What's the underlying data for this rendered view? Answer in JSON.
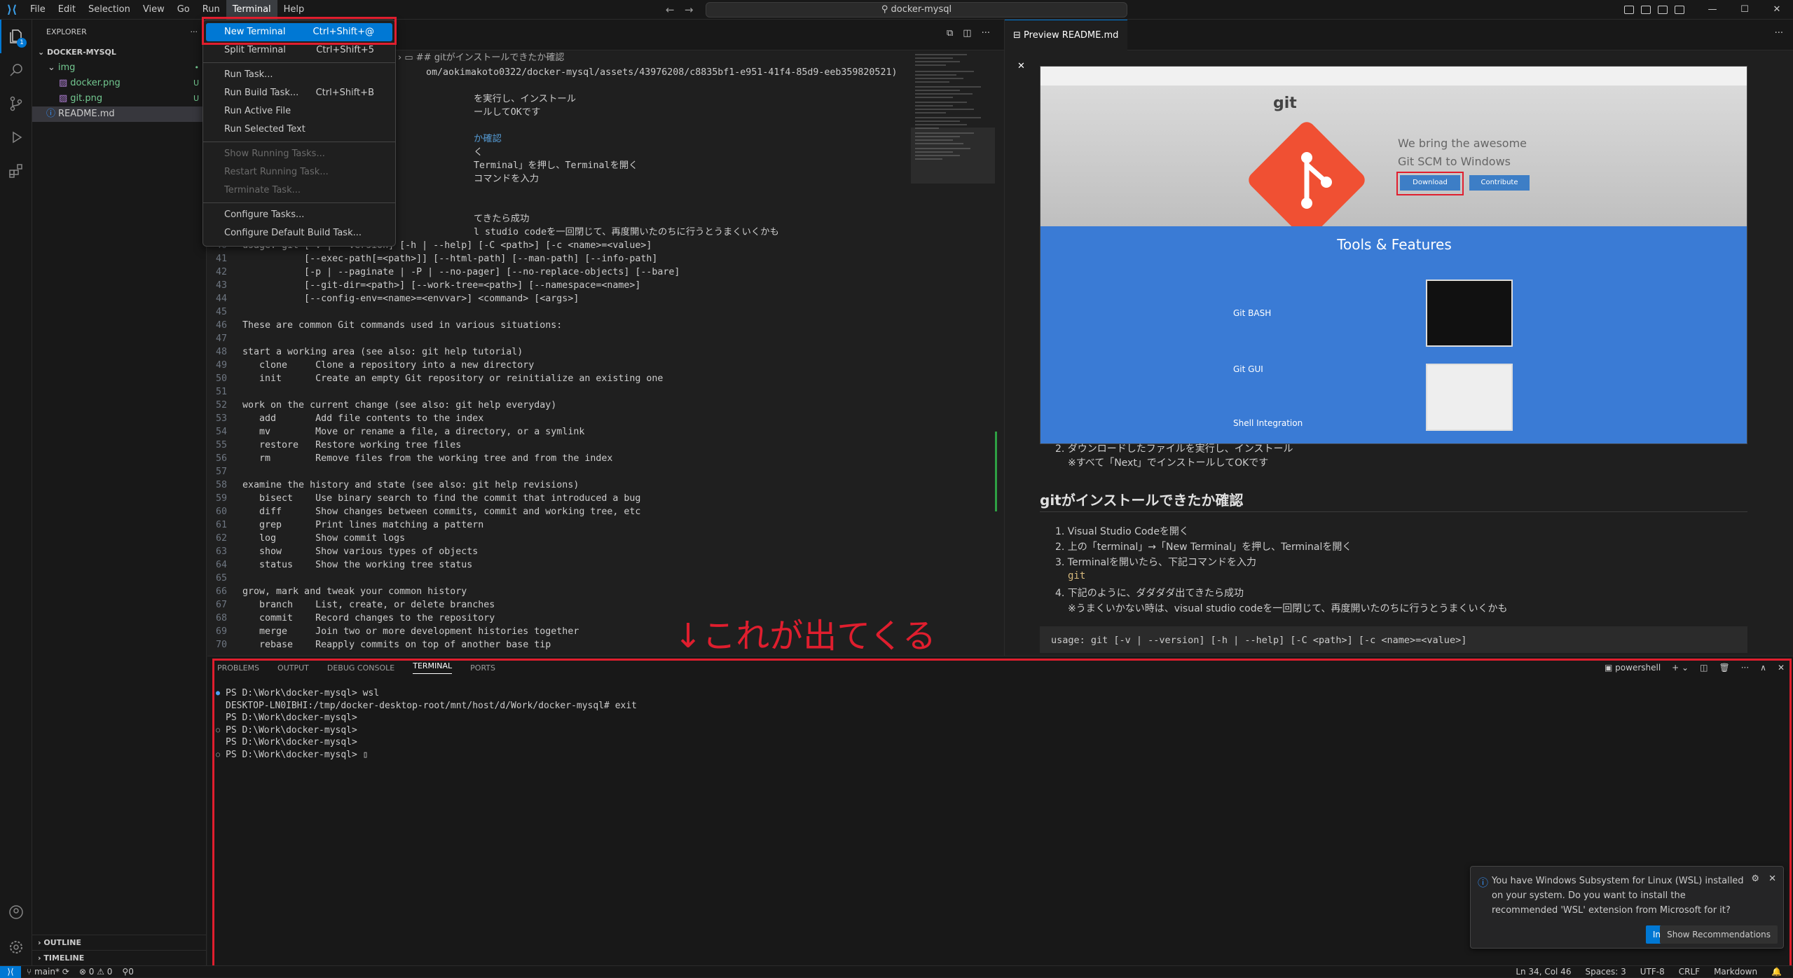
{
  "menubar": {
    "items": [
      "File",
      "Edit",
      "Selection",
      "View",
      "Go",
      "Run",
      "Terminal",
      "Help"
    ],
    "active": "Terminal"
  },
  "search": {
    "label": "docker-mysql"
  },
  "terminal_menu": {
    "items": [
      {
        "label": "New Terminal",
        "shortcut": "Ctrl+Shift+@",
        "state": "highlighted"
      },
      {
        "label": "Split Terminal",
        "shortcut": "Ctrl+Shift+5",
        "state": "normal"
      },
      {
        "label": "Run Task...",
        "shortcut": "",
        "state": "normal"
      },
      {
        "label": "Run Build Task...",
        "shortcut": "Ctrl+Shift+B",
        "state": "normal"
      },
      {
        "label": "Run Active File",
        "shortcut": "",
        "state": "normal"
      },
      {
        "label": "Run Selected Text",
        "shortcut": "",
        "state": "normal"
      },
      {
        "label": "Show Running Tasks...",
        "shortcut": "",
        "state": "disabled"
      },
      {
        "label": "Restart Running Task...",
        "shortcut": "",
        "state": "disabled"
      },
      {
        "label": "Terminate Task...",
        "shortcut": "",
        "state": "disabled"
      },
      {
        "label": "Configure Tasks...",
        "shortcut": "",
        "state": "normal"
      },
      {
        "label": "Configure Default Build Task...",
        "shortcut": "",
        "state": "normal"
      }
    ]
  },
  "sidebar": {
    "title": "EXPLORER",
    "root": "DOCKER-MYSQL",
    "tree": [
      {
        "name": "img",
        "type": "folder",
        "decoration": "•"
      },
      {
        "name": "docker.png",
        "type": "file",
        "decoration": "U"
      },
      {
        "name": "git.png",
        "type": "file",
        "decoration": "U"
      },
      {
        "name": "README.md",
        "type": "file",
        "decoration": ""
      }
    ],
    "outline": "OUTLINE",
    "timeline": "TIMELINE"
  },
  "editor": {
    "breadcrumb": "## gitがインストールできたか確認",
    "top_lines": [
      {
        "n": "",
        "t": "om/aokimakoto0322/docker-mysql/assets/43976208/c8835bf1-e951-41f4-85d9-eeb359820521)"
      },
      {
        "n": "",
        "t": ""
      },
      {
        "n": "",
        "t": "を実行し、インストール"
      },
      {
        "n": "",
        "t": "ールしてOKです"
      },
      {
        "n": "",
        "t": ""
      },
      {
        "n": "",
        "t": "か確認"
      },
      {
        "n": "",
        "t": "く"
      },
      {
        "n": "",
        "t": "Terminal」を押し、Terminalを開く"
      },
      {
        "n": "",
        "t": "コマンドを入力"
      },
      {
        "n": "",
        "t": ""
      },
      {
        "n": "",
        "t": ""
      },
      {
        "n": "",
        "t": "てきたら成功"
      },
      {
        "n": "",
        "t": "l studio codeを一回閉じて、再度開いたのちに行うとうまくいくかも"
      }
    ],
    "lines": [
      {
        "n": "40",
        "t": "usage: git [-v | --version] [-h | --help] [-C <path>] [-c <name>=<value>]"
      },
      {
        "n": "41",
        "t": "           [--exec-path[=<path>]] [--html-path] [--man-path] [--info-path]"
      },
      {
        "n": "42",
        "t": "           [-p | --paginate | -P | --no-pager] [--no-replace-objects] [--bare]"
      },
      {
        "n": "43",
        "t": "           [--git-dir=<path>] [--work-tree=<path>] [--namespace=<name>]"
      },
      {
        "n": "44",
        "t": "           [--config-env=<name>=<envvar>] <command> [<args>]"
      },
      {
        "n": "45",
        "t": ""
      },
      {
        "n": "46",
        "t": "These are common Git commands used in various situations:"
      },
      {
        "n": "47",
        "t": ""
      },
      {
        "n": "48",
        "t": "start a working area (see also: git help tutorial)"
      },
      {
        "n": "49",
        "t": "   clone     Clone a repository into a new directory"
      },
      {
        "n": "50",
        "t": "   init      Create an empty Git repository or reinitialize an existing one"
      },
      {
        "n": "51",
        "t": ""
      },
      {
        "n": "52",
        "t": "work on the current change (see also: git help everyday)"
      },
      {
        "n": "53",
        "t": "   add       Add file contents to the index"
      },
      {
        "n": "54",
        "t": "   mv        Move or rename a file, a directory, or a symlink"
      },
      {
        "n": "55",
        "t": "   restore   Restore working tree files"
      },
      {
        "n": "56",
        "t": "   rm        Remove files from the working tree and from the index"
      },
      {
        "n": "57",
        "t": ""
      },
      {
        "n": "58",
        "t": "examine the history and state (see also: git help revisions)"
      },
      {
        "n": "59",
        "t": "   bisect    Use binary search to find the commit that introduced a bug"
      },
      {
        "n": "60",
        "t": "   diff      Show changes between commits, commit and working tree, etc"
      },
      {
        "n": "61",
        "t": "   grep      Print lines matching a pattern"
      },
      {
        "n": "62",
        "t": "   log       Show commit logs"
      },
      {
        "n": "63",
        "t": "   show      Show various types of objects"
      },
      {
        "n": "64",
        "t": "   status    Show the working tree status"
      },
      {
        "n": "65",
        "t": ""
      },
      {
        "n": "66",
        "t": "grow, mark and tweak your common history"
      },
      {
        "n": "67",
        "t": "   branch    List, create, or delete branches"
      },
      {
        "n": "68",
        "t": "   commit    Record changes to the repository"
      },
      {
        "n": "69",
        "t": "   merge     Join two or more development histories together"
      },
      {
        "n": "70",
        "t": "   rebase    Reapply commits on top of another base tip"
      }
    ]
  },
  "preview": {
    "tab": "Preview README.md",
    "website": {
      "brand": "git",
      "tagline_1": "We bring the awesome",
      "tagline_2": "Git SCM to Windows",
      "download": "Download",
      "contribute": "Contribute",
      "section": "Tools & Features",
      "features": [
        "Git BASH",
        "Git GUI",
        "Shell Integration"
      ]
    },
    "list1": [
      "2. ダウンロードしたファイルを実行し、インストール",
      "※すべて「Next」でインストールしてOKです"
    ],
    "heading": "gitがインストールできたか確認",
    "list2": [
      "1. Visual Studio Codeを開く",
      "2. 上の「terminal」→「New Terminal」を押し、Terminalを開く",
      "3. Terminalを開いたら、下記コマンドを入力",
      "git",
      "4. 下記のように、ダダダダ出てきたら成功",
      "※うまくいかない時は、visual studio codeを一回閉じて、再度開いたのちに行うとうまくいくかも"
    ],
    "code": "usage: git [-v | --version] [-h | --help] [-C <path>] [-c <name>=<value>]"
  },
  "annotation": "↓これが出てくる",
  "panel": {
    "tabs": [
      "PROBLEMS",
      "OUTPUT",
      "DEBUG CONSOLE",
      "TERMINAL",
      "PORTS"
    ],
    "active_tab": "TERMINAL",
    "shell": "powershell",
    "lines": [
      {
        "dot": "blue",
        "t": "PS D:\\Work\\docker-mysql> wsl"
      },
      {
        "dot": "",
        "t": "DESKTOP-LN0IBHI:/tmp/docker-desktop-root/mnt/host/d/Work/docker-mysql# exit"
      },
      {
        "dot": "",
        "t": "PS D:\\Work\\docker-mysql>"
      },
      {
        "dot": "grey",
        "t": "PS D:\\Work\\docker-mysql>"
      },
      {
        "dot": "",
        "t": "PS D:\\Work\\docker-mysql>"
      },
      {
        "dot": "grey",
        "t": "PS D:\\Work\\docker-mysql> ▯"
      }
    ]
  },
  "notification": {
    "message": "You have Windows Subsystem for Linux (WSL) installed on your system. Do you want to install the recommended 'WSL' extension from Microsoft for it?",
    "install": "Install",
    "recommend": "Show Recommendations"
  },
  "statusbar": {
    "branch": "main*",
    "problems": "⊗ 0 ⚠ 0",
    "ports": "⚲0",
    "position": "Ln 34, Col 46",
    "spaces": "Spaces: 3",
    "encoding": "UTF-8",
    "eol": "CRLF",
    "language": "Markdown"
  },
  "colors": {
    "accent": "#0078d4",
    "highlight": "#e01e2e",
    "git_brand": "#f05033"
  }
}
